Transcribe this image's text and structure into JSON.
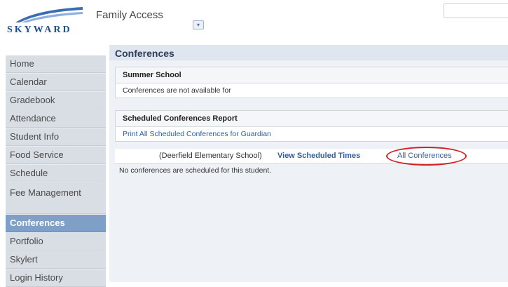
{
  "brand": {
    "logo_text": "SKYWARD",
    "app_title": "Family Access",
    "dropdown_glyph": "▾"
  },
  "sidebar": {
    "items": [
      {
        "label": "Home",
        "active": false
      },
      {
        "label": "Calendar",
        "active": false
      },
      {
        "label": "Gradebook",
        "active": false
      },
      {
        "label": "Attendance",
        "active": false
      },
      {
        "label": "Student Info",
        "active": false
      },
      {
        "label": "Food Service",
        "active": false
      },
      {
        "label": "Schedule",
        "active": false
      },
      {
        "label": "Fee Management",
        "active": false
      },
      {
        "label": "Conferences",
        "active": true
      },
      {
        "label": "Portfolio",
        "active": false
      },
      {
        "label": "Skylert",
        "active": false
      },
      {
        "label": "Login History",
        "active": false
      }
    ]
  },
  "page": {
    "title": "Conferences",
    "summer": {
      "heading": "Summer School",
      "message": "Conferences are not available for"
    },
    "report": {
      "heading": "Scheduled Conferences Report",
      "link": "Print All Scheduled Conferences for Guardian"
    },
    "student_row": {
      "school": "(Deerfield Elementary School)",
      "view_times": "View Scheduled Times",
      "all_conferences": "All Conferences"
    },
    "no_conferences": "No conferences are scheduled for this student."
  },
  "colors": {
    "highlight_circle": "#d41f26",
    "active_nav": "#7e9fc6",
    "link": "#2f5f9e"
  }
}
